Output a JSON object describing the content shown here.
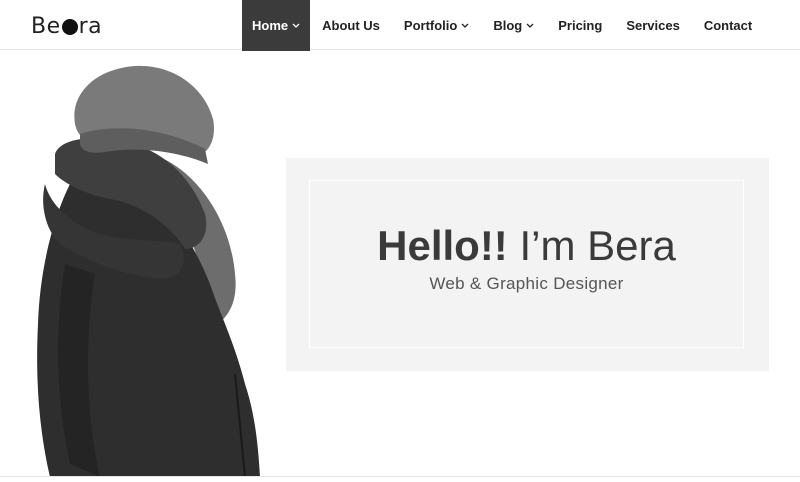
{
  "brand": {
    "logo_text_left": "Be",
    "logo_text_right": "ra"
  },
  "nav": {
    "items": [
      {
        "label": "Home",
        "dropdown": true,
        "active": true
      },
      {
        "label": "About Us",
        "dropdown": false
      },
      {
        "label": "Portfolio",
        "dropdown": true
      },
      {
        "label": "Blog",
        "dropdown": true
      },
      {
        "label": "Pricing",
        "dropdown": false
      },
      {
        "label": "Services",
        "dropdown": false
      },
      {
        "label": "Contact",
        "dropdown": false
      }
    ]
  },
  "hero": {
    "greeting_bold": "Hello!!",
    "greeting_rest": " I’m Bera",
    "subtitle": "Web & Graphic Designer"
  },
  "colors": {
    "active_nav_bg": "#3b3b3b",
    "card_bg": "#f3f3f3"
  }
}
